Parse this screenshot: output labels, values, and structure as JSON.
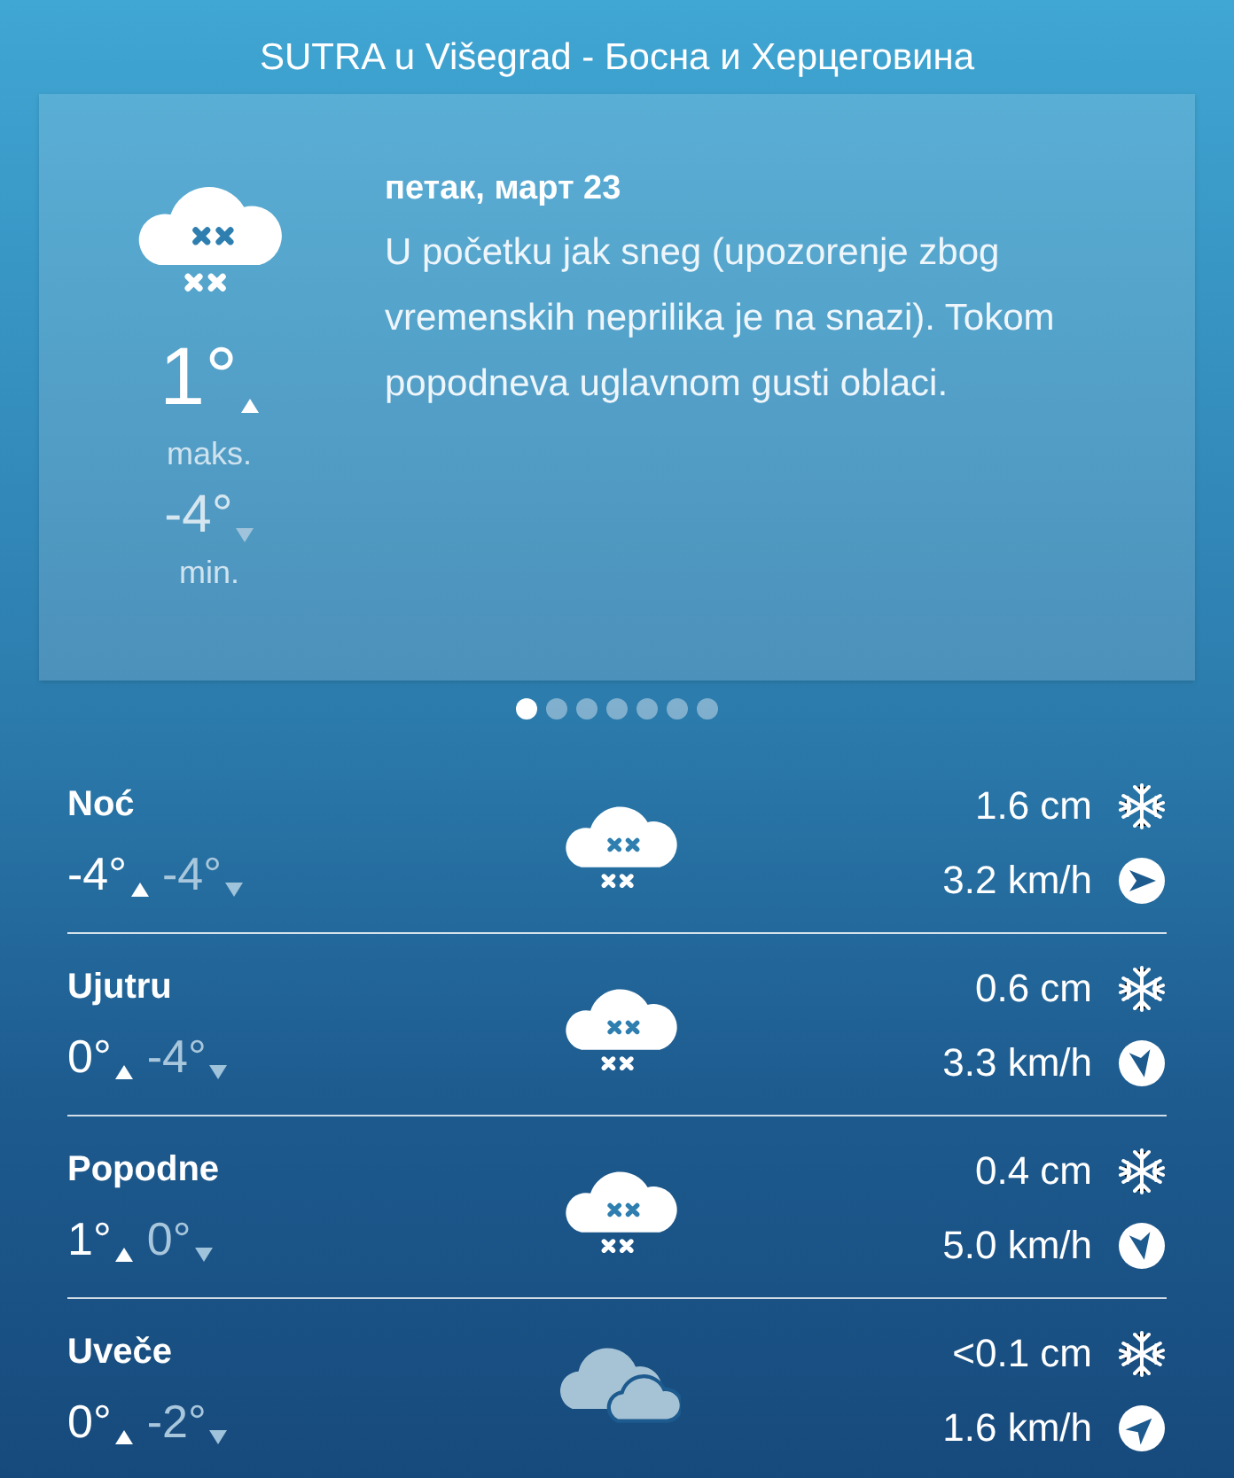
{
  "header": {
    "title": "SUTRA u Višegrad - Босна и Херцеговина"
  },
  "day_card": {
    "kind": "snow",
    "max_temp": "1°",
    "max_label": "maks.",
    "min_temp": "-4°",
    "min_label": "min.",
    "date": "петак, март 23",
    "description": "U početku jak sneg (upozorenje zbog vremenskih neprilika je na snazi). Tokom popodneva uglavnom gusti oblaci."
  },
  "pager": [
    {
      "selected": true
    },
    {
      "selected": false
    },
    {
      "selected": false
    },
    {
      "selected": false
    },
    {
      "selected": false
    },
    {
      "selected": false
    },
    {
      "selected": false
    }
  ],
  "periods": [
    {
      "name": "Noć",
      "high": "-4°",
      "low": "-4°",
      "kind": "snow",
      "snow": "1.6 cm",
      "wind": "3.2 km/h",
      "wind_arrow": {
        "kind": "east"
      }
    },
    {
      "name": "Ujutru",
      "high": "0°",
      "low": "-4°",
      "kind": "snow",
      "snow": "0.6 cm",
      "wind": "3.3 km/h",
      "wind_arrow": {
        "kind": "south"
      }
    },
    {
      "name": "Popodne",
      "high": "1°",
      "low": "0°",
      "kind": "snow",
      "snow": "0.4 cm",
      "wind": "5.0 km/h",
      "wind_arrow": {
        "kind": "south"
      }
    },
    {
      "name": "Uveče",
      "high": "0°",
      "low": "-2°",
      "kind": "cloudy",
      "snow": "<0.1 cm",
      "wind": "1.6 km/h",
      "wind_arrow": {
        "kind": "northeast"
      }
    }
  ]
}
